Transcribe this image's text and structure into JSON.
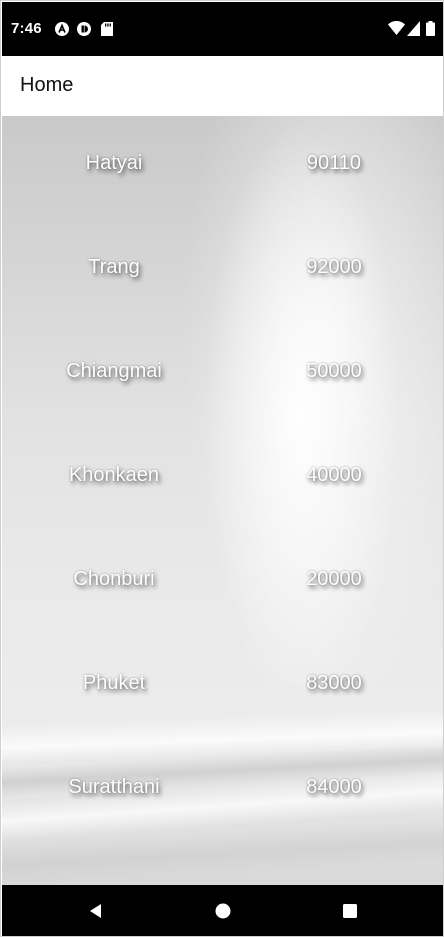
{
  "status_bar": {
    "time": "7:46",
    "left_icons": [
      "autofill-a-icon",
      "cast-circle-icon",
      "sd-card-icon"
    ],
    "right_icons": [
      "wifi-icon",
      "cell-signal-icon",
      "battery-icon"
    ]
  },
  "app_bar": {
    "title": "Home"
  },
  "locations": [
    {
      "city": "Hatyai",
      "code": "90110"
    },
    {
      "city": "Trang",
      "code": "92000"
    },
    {
      "city": "Chiangmai",
      "code": "50000"
    },
    {
      "city": "Khonkaen",
      "code": "40000"
    },
    {
      "city": "Chonburi",
      "code": "20000"
    },
    {
      "city": "Phuket",
      "code": "83000"
    },
    {
      "city": "Suratthani",
      "code": "84000"
    }
  ],
  "nav_bar": {
    "buttons": [
      "back-icon",
      "home-icon",
      "recents-icon"
    ]
  },
  "colors": {
    "status_bar_bg": "#000000",
    "app_bar_bg": "#ffffff",
    "text_on_image": "#ffffff"
  }
}
